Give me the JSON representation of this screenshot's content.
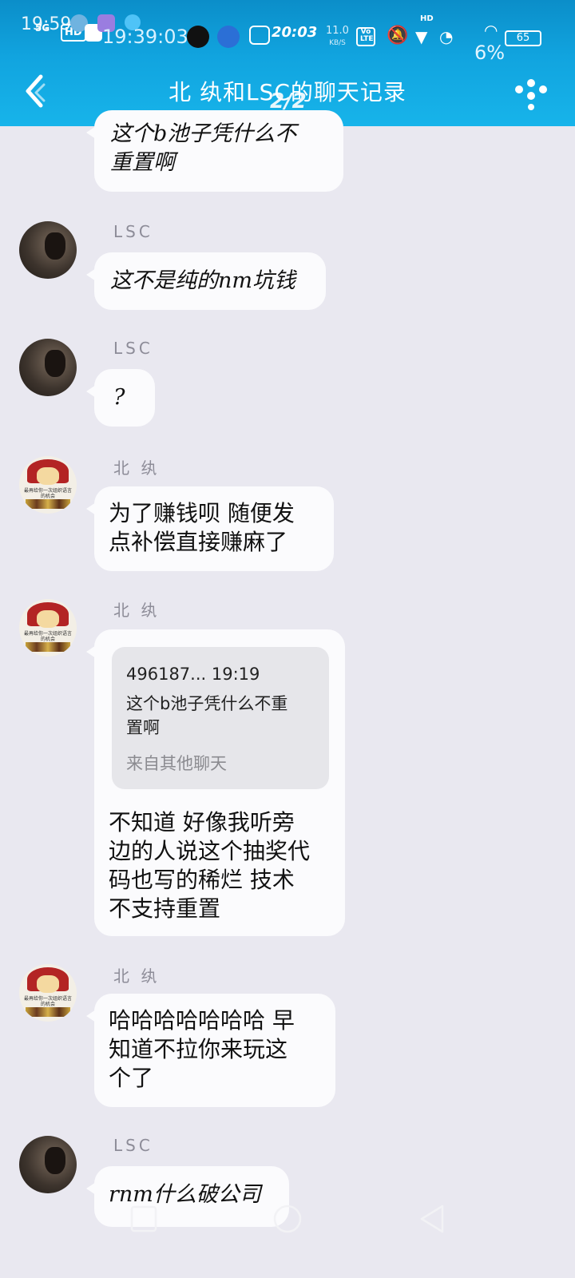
{
  "status_bar": {
    "time_left": "19:59",
    "network": "5G",
    "hd_badge": "HD",
    "clock_overlay": "19:39:03",
    "clock_right": "20:03",
    "speed": "11.0",
    "speed_unit": "KB/S",
    "volte": "Vo LTE",
    "hd_small": "HD",
    "battery": "65",
    "battery_pct": "6%"
  },
  "header": {
    "title": "北 纨和LSC的聊天记录",
    "page_indicator": "2/2"
  },
  "messages": [
    {
      "sender": "",
      "text_lines": [
        "这个b池子凭什么不",
        "重置啊"
      ]
    },
    {
      "sender": "LSC",
      "text_lines": [
        "这不是纯的nm坑钱"
      ]
    },
    {
      "sender": "LSC",
      "text_lines": [
        "?"
      ]
    },
    {
      "sender": "北 纨",
      "text_lines": [
        "为了赚钱呗 随便发",
        "点补偿直接赚麻了"
      ]
    },
    {
      "sender": "北 纨",
      "quote": {
        "head": "496187... 19:19",
        "body_lines": [
          "这个b池子凭什么不重",
          "置啊"
        ],
        "source": "来自其他聊天"
      },
      "text_lines": [
        "不知道 好像我听旁",
        "边的人说这个抽奖代",
        "码也写的稀烂 技术",
        "不支持重置"
      ]
    },
    {
      "sender": "北 纨",
      "text_lines": [
        "哈哈哈哈哈哈哈 早",
        "知道不拉你来玩这",
        "个了"
      ]
    },
    {
      "sender": "LSC",
      "text_lines": [
        "rnm什么破公司"
      ]
    }
  ],
  "avatar_caption": "最再给你一次组织语言的机会",
  "colors": {
    "header_top": "#0b8ec9",
    "header_bottom": "#17b4ea",
    "background": "#e9e8f0",
    "bubble": "#fbfbfd",
    "quote_bg": "#e6e6ea"
  }
}
